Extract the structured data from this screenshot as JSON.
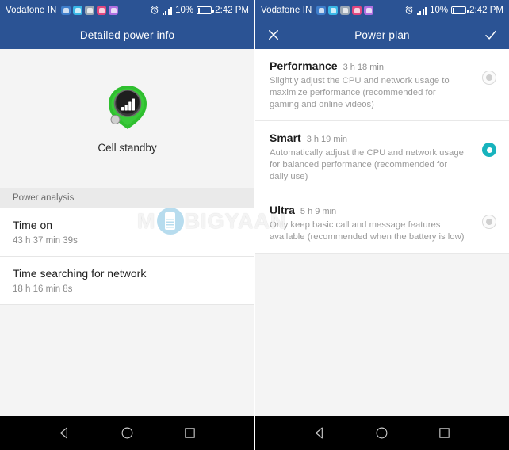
{
  "statusbar": {
    "carrier": "Vodafone IN",
    "battery_percent": "10%",
    "clock": "2:42 PM",
    "icons": {
      "alarm": "alarm-clock-icon",
      "signal": "signal-bars-icon",
      "battery": "battery-icon"
    },
    "notification_icons": [
      "notification-icon-1",
      "notification-icon-2",
      "notification-icon-3",
      "notification-icon-4",
      "notification-icon-5"
    ]
  },
  "left": {
    "appbar": {
      "title": "Detailed power info"
    },
    "hero": {
      "label": "Cell standby",
      "icon": "cell-standby-icon"
    },
    "section_header": "Power analysis",
    "rows": [
      {
        "title": "Time on",
        "value": "43 h 37 min 39s"
      },
      {
        "title": "Time searching for network",
        "value": "18 h 16 min 8s"
      }
    ]
  },
  "right": {
    "appbar": {
      "title": "Power plan",
      "close_icon": "close-icon",
      "confirm_icon": "check-icon"
    },
    "plans": [
      {
        "name": "Performance",
        "time": "3 h 18 min",
        "description": "Slightly adjust the CPU and network usage to maximize performance (recommended for gaming and online videos)",
        "selected": false
      },
      {
        "name": "Smart",
        "time": "3 h 19 min",
        "description": "Automatically adjust the CPU and network usage for balanced performance (recommended for daily use)",
        "selected": true
      },
      {
        "name": "Ultra",
        "time": "5 h 9 min",
        "description": "Only keep basic call and message features available (recommended when the battery is low)",
        "selected": false
      }
    ]
  },
  "watermark": {
    "text_left": "M",
    "text_right": "BIGYAAN"
  },
  "navbar": {
    "back": "back-triangle-icon",
    "home": "home-circle-icon",
    "recents": "recents-square-icon"
  },
  "colors": {
    "appbar_blue": "#2b5394",
    "accent_teal": "#17b3bd",
    "body_gray": "#f4f4f4"
  }
}
